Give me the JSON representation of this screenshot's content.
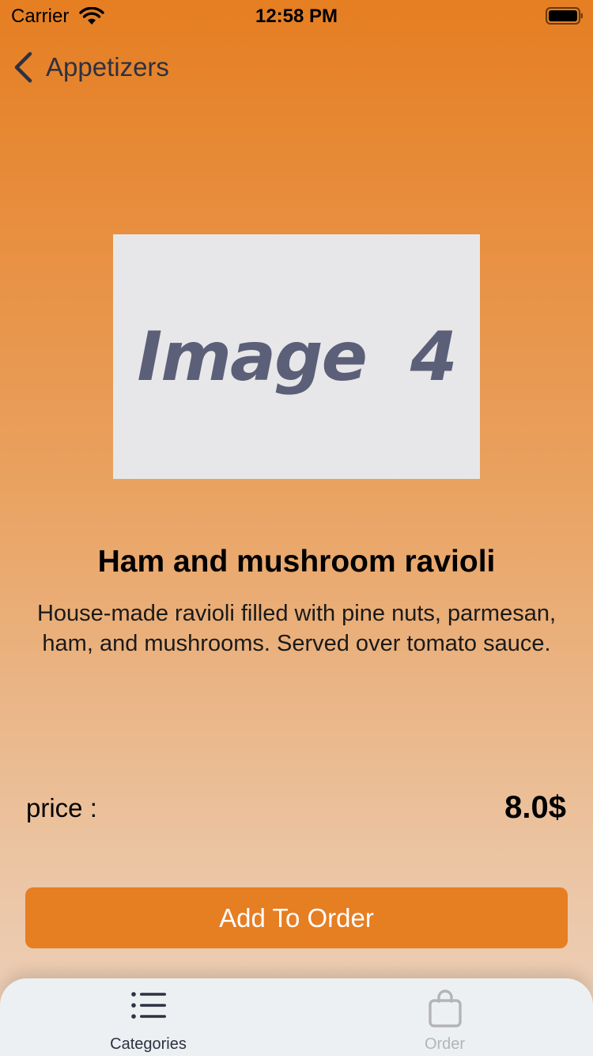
{
  "status_bar": {
    "carrier": "Carrier",
    "time": "12:58 PM",
    "icons": [
      "wifi-icon",
      "battery-icon"
    ]
  },
  "nav": {
    "back_label": "Appetizers",
    "back_icon": "chevron-left-icon"
  },
  "dish": {
    "image_placeholder": "Image  4",
    "name": "Ham and mushroom ravioli",
    "description": "House-made ravioli filled with pine nuts, parmesan, ham, and mushrooms. Served over tomato sauce.",
    "price_label": "price :",
    "price_value": "8.0$"
  },
  "actions": {
    "add_to_order_label": "Add To Order"
  },
  "tab_bar": {
    "tabs": [
      {
        "label": "Categories",
        "icon": "list-icon",
        "active": true
      },
      {
        "label": "Order",
        "icon": "shopping-bag-icon",
        "active": false
      }
    ]
  },
  "colors": {
    "accent": "#e67e22",
    "gradient_top": "#e67e22",
    "gradient_bottom": "#edd2bd",
    "tab_active": "#2d3142",
    "tab_inactive": "#b4b4b6"
  }
}
